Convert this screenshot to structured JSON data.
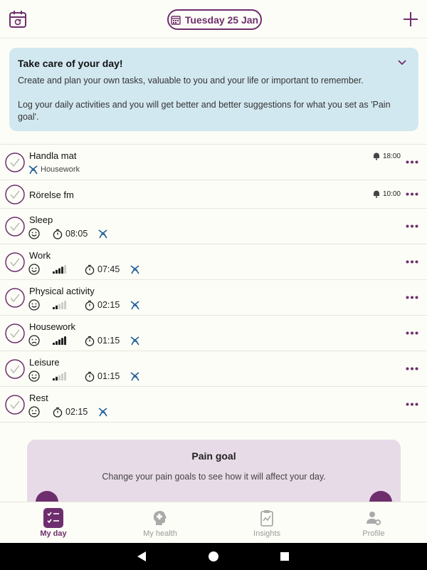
{
  "header": {
    "date_label": "Tuesday 25 Jan",
    "accent": "#6e2e6e"
  },
  "info_card": {
    "title": "Take care of your day!",
    "line1": "Create and plan your own tasks, valuable to you and your life or important to remember.",
    "line2": "Log your daily activities and you will get better and better suggestions for what you set as 'Pain goal'."
  },
  "tasks": [
    {
      "title": "Handla mat",
      "category": "Housework",
      "alarm": "18:00"
    },
    {
      "title": "Rörelse fm",
      "alarm": "10:00"
    }
  ],
  "activities": [
    {
      "title": "Sleep",
      "mood": "happy",
      "time": "08:05"
    },
    {
      "title": "Work",
      "mood": "happy",
      "level": 4,
      "time": "07:45"
    },
    {
      "title": "Physical activity",
      "mood": "happy",
      "level": 2,
      "time": "02:15"
    },
    {
      "title": "Housework",
      "mood": "sad",
      "level": 5,
      "time": "01:15"
    },
    {
      "title": "Leisure",
      "mood": "happy",
      "level": 2,
      "time": "01:15"
    },
    {
      "title": "Rest",
      "mood": "neutral",
      "time": "02:15"
    }
  ],
  "pain_goal": {
    "title": "Pain goal",
    "text": "Change your pain goals to see how it will affect your day."
  },
  "nav": [
    {
      "label": "My day",
      "active": true
    },
    {
      "label": "My health"
    },
    {
      "label": "Insights"
    },
    {
      "label": "Profile"
    }
  ]
}
